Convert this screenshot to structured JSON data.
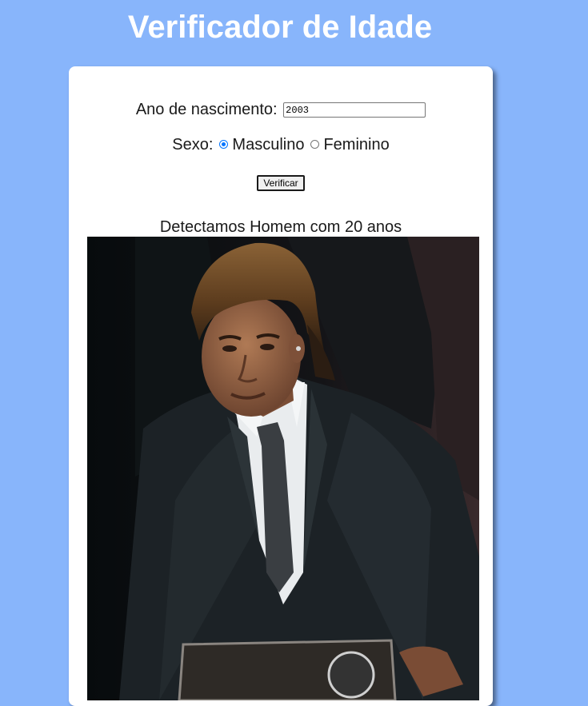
{
  "header": {
    "title": "Verificador de Idade"
  },
  "form": {
    "year_label": "Ano de nascimento:",
    "year_value": "2003",
    "sex_label": "Sexo:",
    "sex_options": [
      "Masculino",
      "Feminino"
    ],
    "sex_selected": "Masculino",
    "verify_label": "Verificar"
  },
  "result": {
    "text": "Detectamos Homem com 20 anos"
  },
  "colors": {
    "background": "#88b5fb",
    "card": "#ffffff",
    "radio_accent": "#0075ff"
  }
}
